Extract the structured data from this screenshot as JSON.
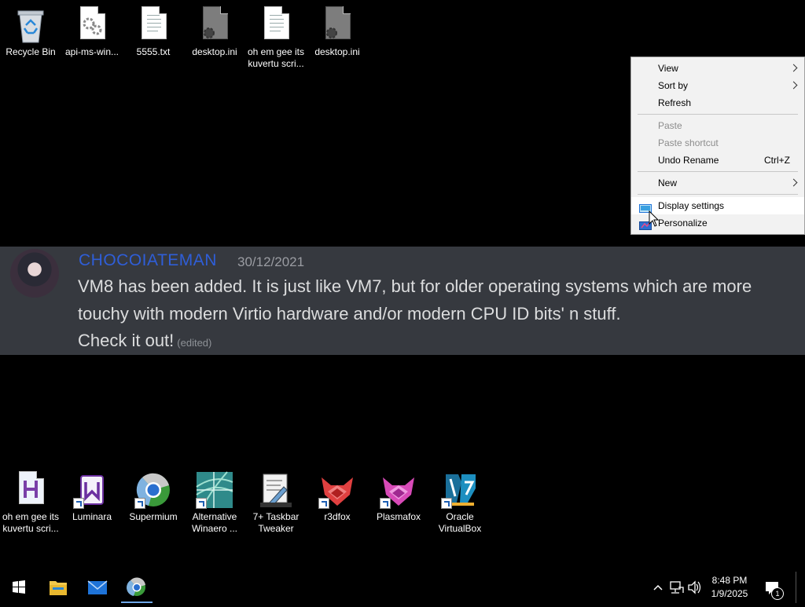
{
  "desktop": {
    "top_icons": [
      {
        "label": "Recycle Bin"
      },
      {
        "label": "api-ms-win..."
      },
      {
        "label": "5555.txt"
      },
      {
        "label": "desktop.ini"
      },
      {
        "label": "oh em gee its\nkuvertu scri..."
      },
      {
        "label": "desktop.ini"
      }
    ],
    "bottom_icons": [
      {
        "label": "oh em gee its\nkuvertu scri..."
      },
      {
        "label": "Luminara"
      },
      {
        "label": "Supermium"
      },
      {
        "label": "Alternative\nWinaero ..."
      },
      {
        "label": "7+ Taskbar\nTweaker"
      },
      {
        "label": "r3dfox"
      },
      {
        "label": "Plasmafox"
      },
      {
        "label": "Oracle\nVirtualBox"
      }
    ]
  },
  "context_menu": {
    "items": [
      {
        "label": "View"
      },
      {
        "label": "Sort by"
      },
      {
        "label": "Refresh"
      },
      {
        "label": "Paste"
      },
      {
        "label": "Paste shortcut"
      },
      {
        "label": "Undo Rename",
        "shortcut": "Ctrl+Z"
      },
      {
        "label": "New"
      },
      {
        "label": "Display settings"
      },
      {
        "label": "Personalize"
      }
    ]
  },
  "chat": {
    "username": "CHOCOIATEMAN",
    "date": "30/12/2021",
    "line1": "VM8 has been added. It is just like VM7, but for older operating systems which are more",
    "line2": "touchy with modern Virtio hardware and/or modern CPU ID bits' n stuff.",
    "line3": "Check it out!",
    "edited": "(edited)"
  },
  "taskbar": {
    "time": "8:48 PM",
    "date": "1/9/2025",
    "notification_count": "1"
  },
  "colors": {
    "accent_blue": "#1e73d8",
    "chat_bg": "#36393f",
    "username": "#2f5ed8"
  }
}
